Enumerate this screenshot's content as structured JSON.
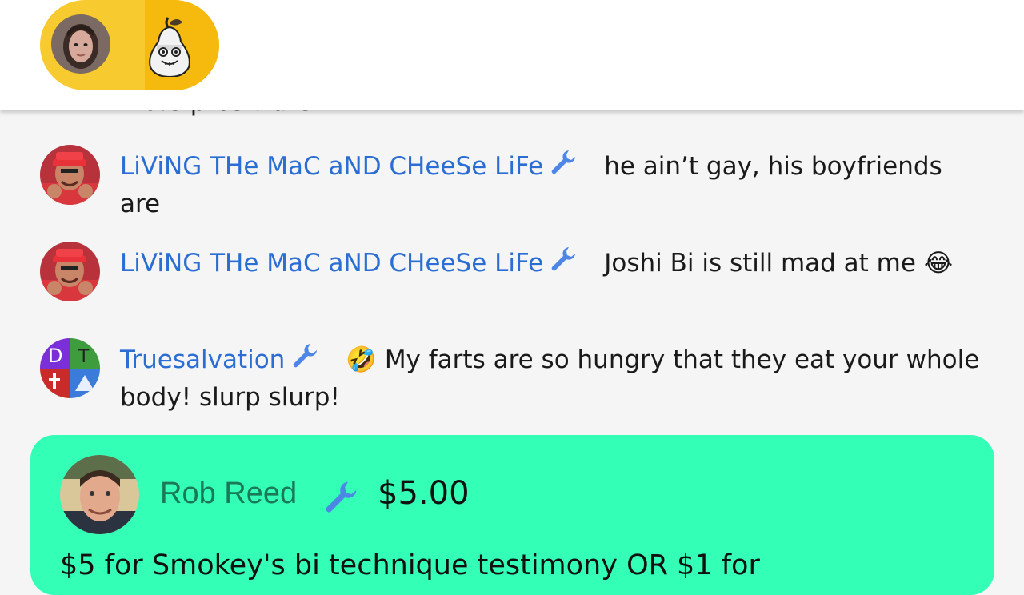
{
  "header": {
    "host_avatar": "host-avatar",
    "mascot_icon": "pear-mascot-icon",
    "pill_colors": [
      "#f7cb2f",
      "#f6b90e"
    ]
  },
  "chat": {
    "cut_off_text": "male prostitute",
    "messages": [
      {
        "username": "LiViNG THe MaC aND CHeeSe LiFe",
        "text": "he ain’t gay, his boyfriends are",
        "badge": "wrench-icon"
      },
      {
        "username": "LiViNG THe MaC aND CHeeSe LiFe",
        "text": "Joshi Bi is still mad at me",
        "emoji": "😂",
        "badge": "wrench-icon"
      },
      {
        "username": "Truesalvation",
        "emoji": "🤣",
        "text": "My farts are so hungry that they eat your whole body! slurp slurp!",
        "badge": "wrench-icon"
      }
    ]
  },
  "donation": {
    "username": "Rob Reed",
    "amount": "$5.00",
    "message": "$5 for Smokey's bi technique testimony OR $1 for",
    "color": "#33ffb6",
    "badge": "wrench-icon"
  },
  "colors": {
    "username": "#2b6ed3",
    "wrench": "#4d86e6"
  }
}
